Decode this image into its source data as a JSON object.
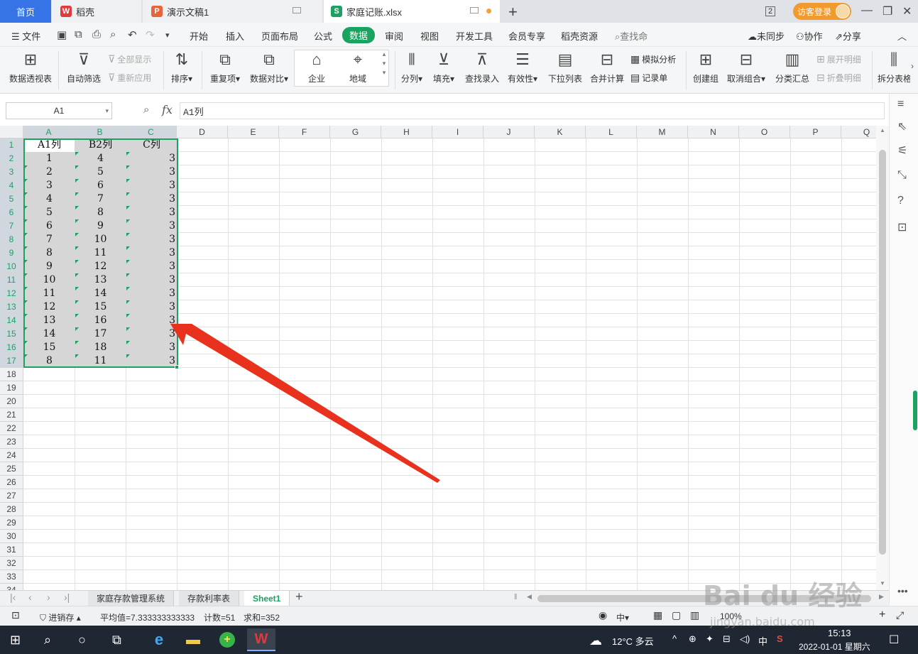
{
  "titlebar": {
    "tabs": [
      {
        "label": "首页"
      },
      {
        "label": "稻壳",
        "icon": "W"
      },
      {
        "label": "演示文稿1",
        "icon": "P"
      },
      {
        "label": "家庭记账.xlsx",
        "icon": "S"
      }
    ],
    "window_count": "2",
    "login": "访客登录"
  },
  "menu": {
    "file": "文件",
    "items": [
      "开始",
      "插入",
      "页面布局",
      "公式",
      "数据",
      "审阅",
      "视图",
      "开发工具",
      "会员专享",
      "稻壳资源"
    ],
    "active": "数据",
    "search": "查找命",
    "sync": "未同步",
    "collab": "协作",
    "share": "分享"
  },
  "ribbon": {
    "pivot": "数据透视表",
    "autofilter": "自动筛选",
    "show_all": "全部显示",
    "reapply": "重新应用",
    "sort": "排序",
    "duplicates": "重复项",
    "compare": "数据对比",
    "enterprise": "企业",
    "region": "地域",
    "split": "分列",
    "fill": "填充",
    "lookup": "查找录入",
    "validity": "有效性",
    "dropdown": "下拉列表",
    "consolidate": "合并计算",
    "whatif": "模拟分析",
    "record": "记录单",
    "group": "创建组",
    "ungroup": "取消组合",
    "subtotal": "分类汇总",
    "expand": "展开明细",
    "collapse": "折叠明细",
    "split_table": "拆分表格"
  },
  "formula": {
    "cell_ref": "A1",
    "fx": "fx",
    "content": "A1列"
  },
  "grid": {
    "columns": [
      "A",
      "B",
      "C",
      "D",
      "E",
      "F",
      "G",
      "H",
      "I",
      "J",
      "K",
      "L",
      "M",
      "N",
      "O",
      "P",
      "Q"
    ],
    "rows": [
      "1",
      "2",
      "3",
      "4",
      "5",
      "6",
      "7",
      "8",
      "9",
      "10",
      "11",
      "12",
      "13",
      "14",
      "15",
      "16",
      "17",
      "18",
      "19",
      "20",
      "21",
      "22",
      "23",
      "24",
      "25",
      "26",
      "27",
      "28",
      "29",
      "30",
      "31",
      "32",
      "33",
      "34"
    ],
    "headers": [
      "A1列",
      "B2列",
      "C列"
    ],
    "colA": [
      "1",
      "2",
      "3",
      "4",
      "5",
      "6",
      "7",
      "8",
      "9",
      "10",
      "11",
      "12",
      "13",
      "14",
      "15",
      "8"
    ],
    "colB": [
      "4",
      "5",
      "6",
      "7",
      "8",
      "9",
      "10",
      "11",
      "12",
      "13",
      "14",
      "15",
      "16",
      "17",
      "18",
      "11"
    ],
    "colC": [
      "3",
      "3",
      "3",
      "3",
      "3",
      "3",
      "3",
      "3",
      "3",
      "3",
      "3",
      "3",
      "3",
      "3",
      "3",
      "3"
    ]
  },
  "sheets": {
    "tabs": [
      "家庭存款管理系统",
      "存款利率表",
      "Sheet1"
    ],
    "active": "Sheet1"
  },
  "status": {
    "backup": "进销存",
    "average": "平均值=7.333333333333",
    "count": "计数=51",
    "sum": "求和=352",
    "zoom": "100%"
  },
  "taskbar": {
    "weather": "12°C  多云",
    "ime": "中",
    "time": "15:13",
    "date": "2022-01-01 星期六"
  },
  "watermark": {
    "brand": "Bai  du 经验",
    "url": "jingyan.baidu.com"
  },
  "colors": {
    "accent": "#1aa260",
    "home_tab": "#3573e6",
    "arrow": "#e8321e"
  }
}
